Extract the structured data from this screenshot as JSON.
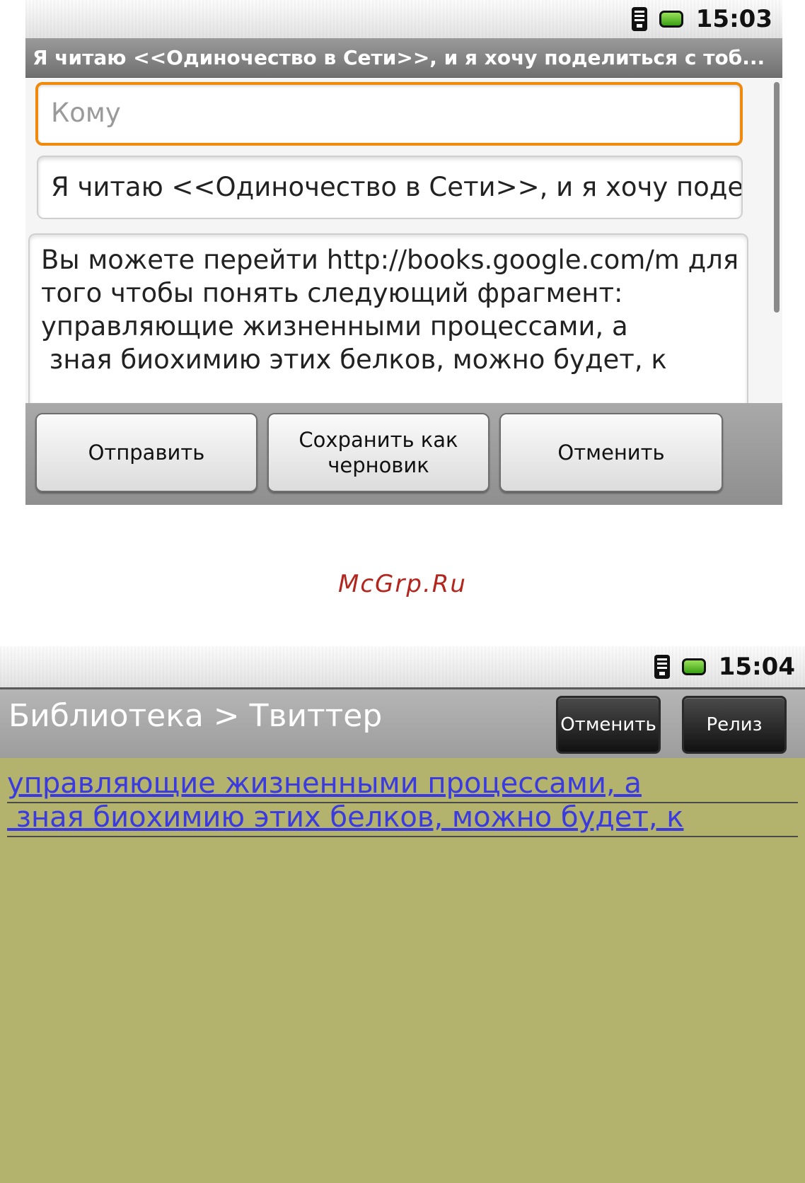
{
  "compose": {
    "status_time": "15:03",
    "title": "Я читаю <<Одиночество в Сети>>, и я хочу поделиться с тоб...",
    "to_placeholder": "Кому",
    "subject_value": "Я читаю <<Одиночество в Сети>>, и я хочу поделит",
    "body_lines": [
      "Вы можете перейти http://books.google.com/m для",
      "того чтобы понять следующий фрагмент:",
      "управляющие жизненными процессами, а",
      " зная биохимию этих белков, можно будет, к"
    ],
    "buttons": {
      "send": "Отправить",
      "save_draft": "Сохранить как\nчерновик",
      "cancel": "Отменить"
    },
    "accent_color": "#f08a0c"
  },
  "watermark": "McGrp.Ru",
  "reader": {
    "status_time": "15:04",
    "breadcrumb": "Библиотека > Твиттер",
    "cancel_button": "Отменить",
    "release_button": "Релиз",
    "lines": [
      "управляющие жизненными процессами, а",
      " зная биохимию этих белков, можно будет, к"
    ],
    "background_color": "#b3b36d",
    "link_color": "#3a3ae0"
  },
  "icons": [
    "signal-icon",
    "battery-icon"
  ]
}
